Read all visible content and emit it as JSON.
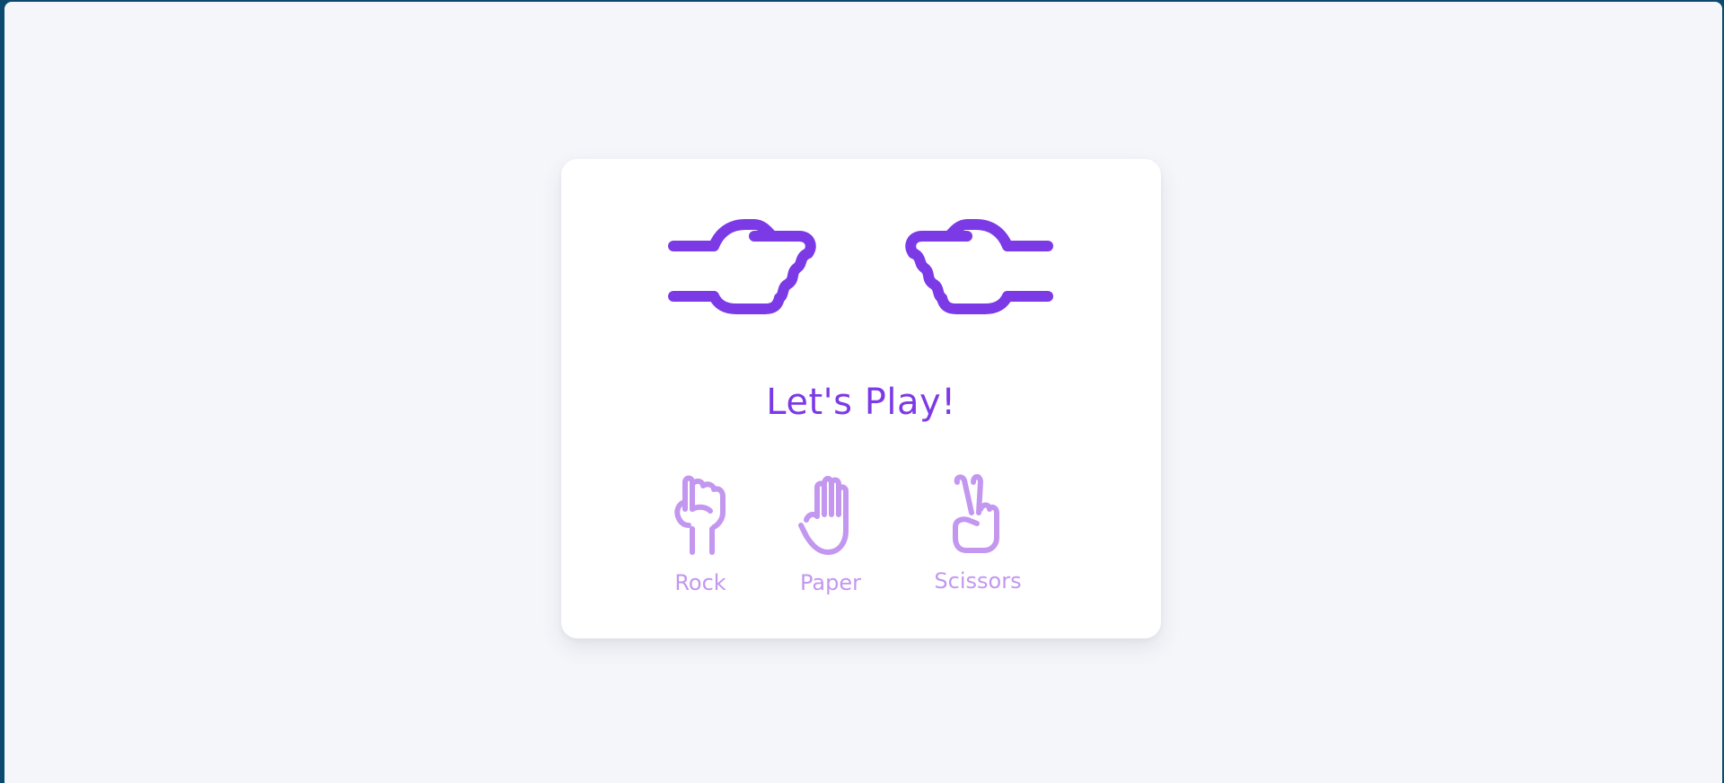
{
  "game": {
    "title": "Let's Play!",
    "player_hand_icon": "fist-pointing-right-icon",
    "computer_hand_icon": "fist-pointing-left-icon"
  },
  "choices": [
    {
      "label": "Rock",
      "icon": "rock-hand-icon"
    },
    {
      "label": "Paper",
      "icon": "paper-hand-icon"
    },
    {
      "label": "Scissors",
      "icon": "scissors-hand-icon"
    }
  ],
  "colors": {
    "accent": "#7c3ae6",
    "choice": "#c397ef",
    "card": "#ffffff",
    "background": "#f5f6fa"
  }
}
